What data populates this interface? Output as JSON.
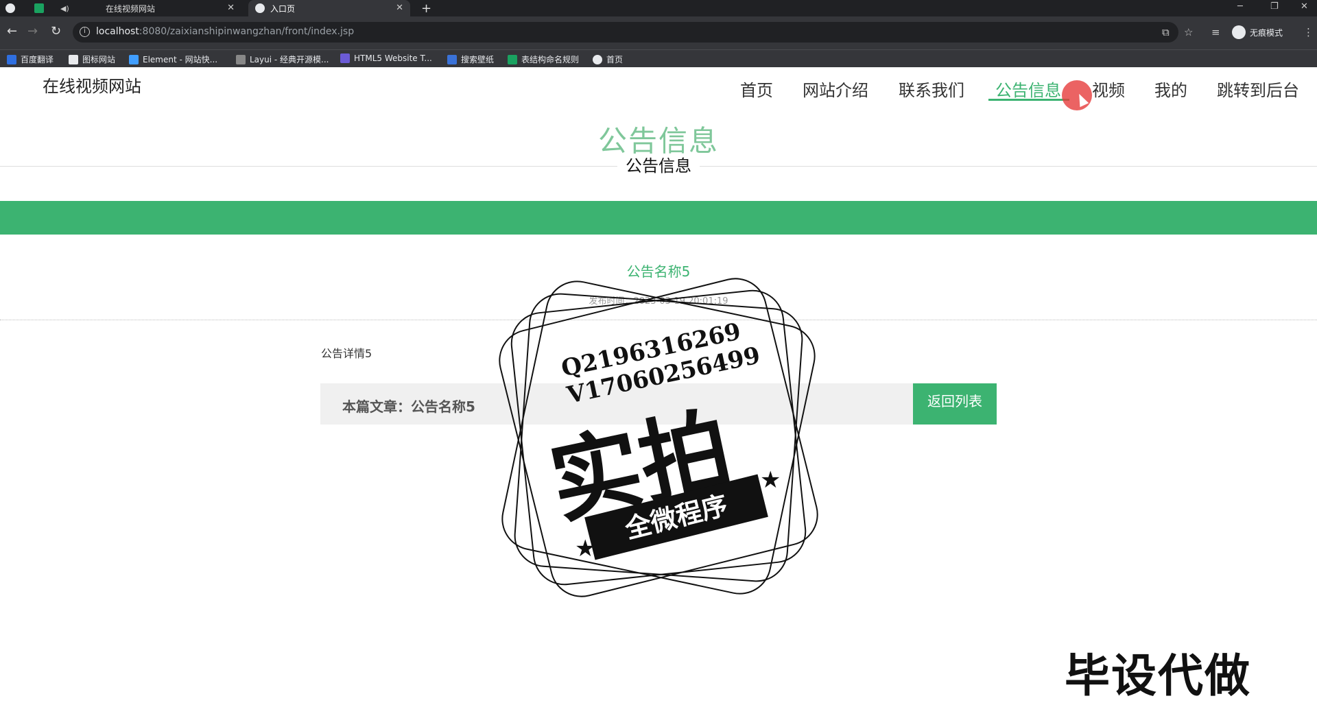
{
  "browser": {
    "tabs": [
      {
        "label": "在线视频网站",
        "active": false
      },
      {
        "label": "入口页",
        "active": true
      }
    ],
    "new_tab_symbol": "+",
    "url_host": "localhost",
    "url_path": ":8080/zaixianshipinwangzhan/front/index.jsp",
    "profile_label": "无痕模式",
    "bookmarks": [
      "百度翻译",
      "图标网站",
      "Element - 网站快...",
      "Layui - 经典开源模...",
      "HTML5 Website T...",
      "搜索壁纸",
      "表结构命名规则",
      "首页"
    ]
  },
  "site": {
    "brand": "在线视频网站",
    "nav": [
      "首页",
      "网站介绍",
      "联系我们",
      "公告信息",
      "视频",
      "我的",
      "跳转到后台"
    ],
    "active_nav": "公告信息"
  },
  "section": {
    "title": "公告信息",
    "subtitle": "公告信息"
  },
  "article": {
    "title": "公告名称5",
    "meta": "发布时间：2023-03-19 20:01:19",
    "detail": "公告详情5",
    "current_label": "本篇文章：公告名称5",
    "back_button": "返回列表"
  },
  "watermark": {
    "line1": "Q2196316269",
    "line2": "V17060256499",
    "big": "实拍",
    "ribbon": "全微程序",
    "corner": "毕设代做"
  },
  "colors": {
    "accent": "#3cb371",
    "chrome_dark": "#202124",
    "chrome_mid": "#35363a"
  }
}
